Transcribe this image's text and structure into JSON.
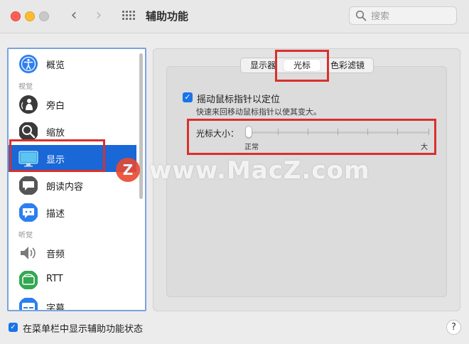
{
  "window": {
    "title": "辅助功能",
    "search_placeholder": "搜索"
  },
  "sidebar": {
    "sections": [
      "视觉",
      "听觉"
    ],
    "items": [
      {
        "label": "概览",
        "icon": "accessibility-icon",
        "color": "#2d7ff0"
      },
      {
        "label": "旁白",
        "icon": "voiceover-icon",
        "color": "#3a3a3a"
      },
      {
        "label": "缩放",
        "icon": "zoom-icon",
        "color": "#3a3a3a"
      },
      {
        "label": "显示",
        "icon": "display-icon",
        "color": "#2aa7e8",
        "selected": true
      },
      {
        "label": "朗读内容",
        "icon": "speech-icon",
        "color": "#555555"
      },
      {
        "label": "描述",
        "icon": "description-icon",
        "color": "#2d7ff0"
      },
      {
        "label": "音频",
        "icon": "speaker-icon",
        "color": "#7a7a7a"
      },
      {
        "label": "RTT",
        "icon": "rtt-icon",
        "color": "#34a853"
      },
      {
        "label": "字幕",
        "icon": "captions-icon",
        "color": "#2d7ff0"
      }
    ]
  },
  "tabs": [
    "显示器",
    "光标",
    "色彩滤镜"
  ],
  "selected_tab": "光标",
  "cursor": {
    "shake_to_locate": {
      "label": "摇动鼠标指针以定位",
      "checked": true
    },
    "shake_desc": "快速来回移动鼠标指针以使其变大。",
    "size_label": "光标大小：",
    "size_min": "正常",
    "size_max": "大",
    "size_value": 0
  },
  "footer": {
    "show_in_menubar_label": "在菜单栏中显示辅助功能状态",
    "show_in_menubar_checked": true,
    "help_label": "?"
  },
  "watermark": {
    "logo": "Z",
    "text": "www.MacZ.com"
  },
  "colors": {
    "accent": "#1a67d8",
    "highlight": "#d9302c"
  }
}
